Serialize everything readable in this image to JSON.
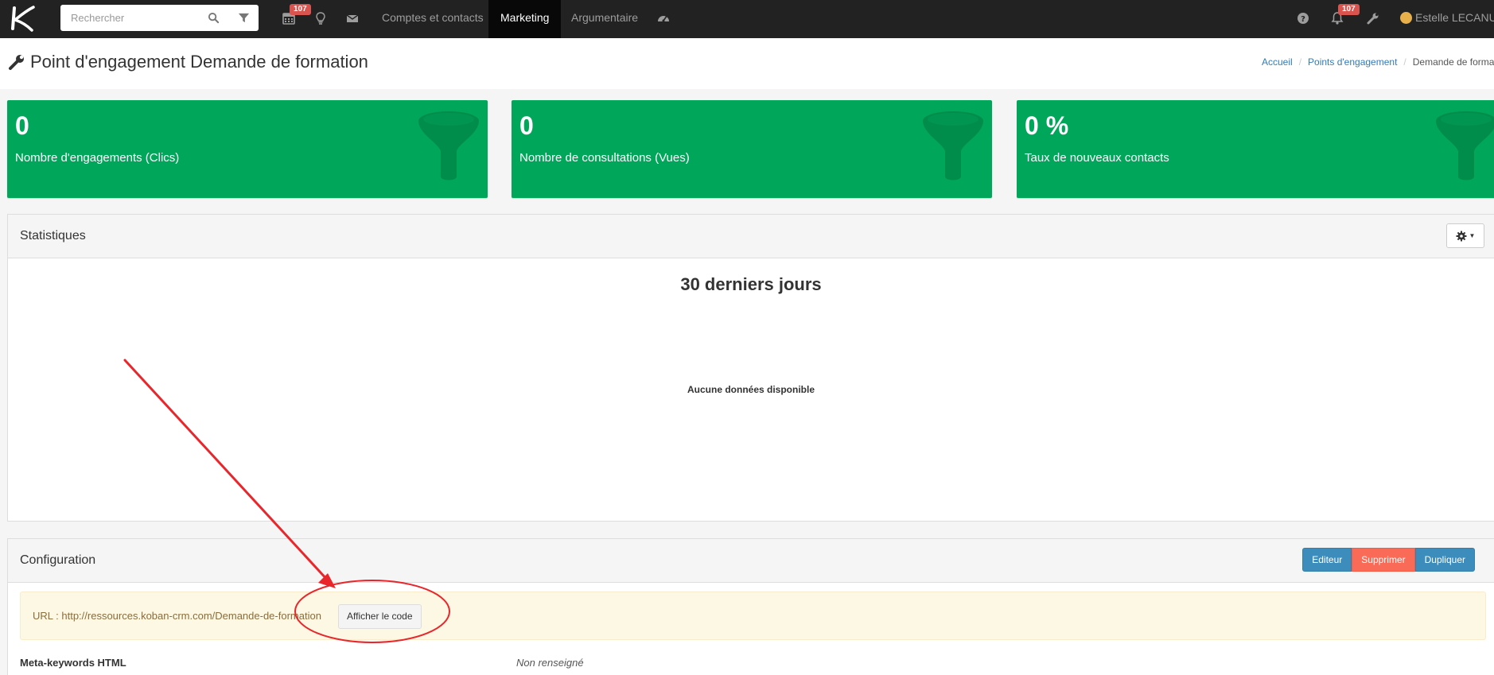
{
  "navbar": {
    "search_placeholder": "Rechercher",
    "calendar_badge": "107",
    "links": [
      "Comptes et contacts",
      "Marketing",
      "Argumentaire"
    ],
    "active_link": "Marketing",
    "notif_badge": "107",
    "user_name": "Estelle LECANU"
  },
  "header": {
    "title": "Point d'engagement Demande de formation",
    "breadcrumb": [
      "Accueil",
      "Points d'engagement",
      "Demande de formation"
    ]
  },
  "stats": [
    {
      "value": "0",
      "label": "Nombre d'engagements (Clics)"
    },
    {
      "value": "0",
      "label": "Nombre de consultations (Vues)"
    },
    {
      "value": "0 %",
      "label": "Taux de nouveaux contacts"
    }
  ],
  "statistiques": {
    "title": "Statistiques",
    "chart_title": "30 derniers jours",
    "no_data": "Aucune données disponible"
  },
  "configuration": {
    "title": "Configuration",
    "buttons": {
      "edit": "Editeur",
      "delete": "Supprimer",
      "duplicate": "Dupliquer"
    },
    "url_text": "URL : http://ressources.koban-crm.com/Demande-de-formation",
    "show_code": "Afficher le code",
    "meta_key": "Meta-keywords HTML",
    "meta_value": "Non renseigné"
  },
  "colors": {
    "navbar": "#222222",
    "stat_green": "#00a65a",
    "btn_blue": "#3c8dbc",
    "btn_red": "#f96b56",
    "annotation": "#e8262b"
  },
  "icons": [
    "logo-icon",
    "search-icon",
    "filter-icon",
    "calendar-icon",
    "lightbulb-icon",
    "envelope-icon",
    "dashboard-icon",
    "question-icon",
    "bell-icon",
    "wrench-icon",
    "funnel-icon",
    "gear-icon"
  ]
}
